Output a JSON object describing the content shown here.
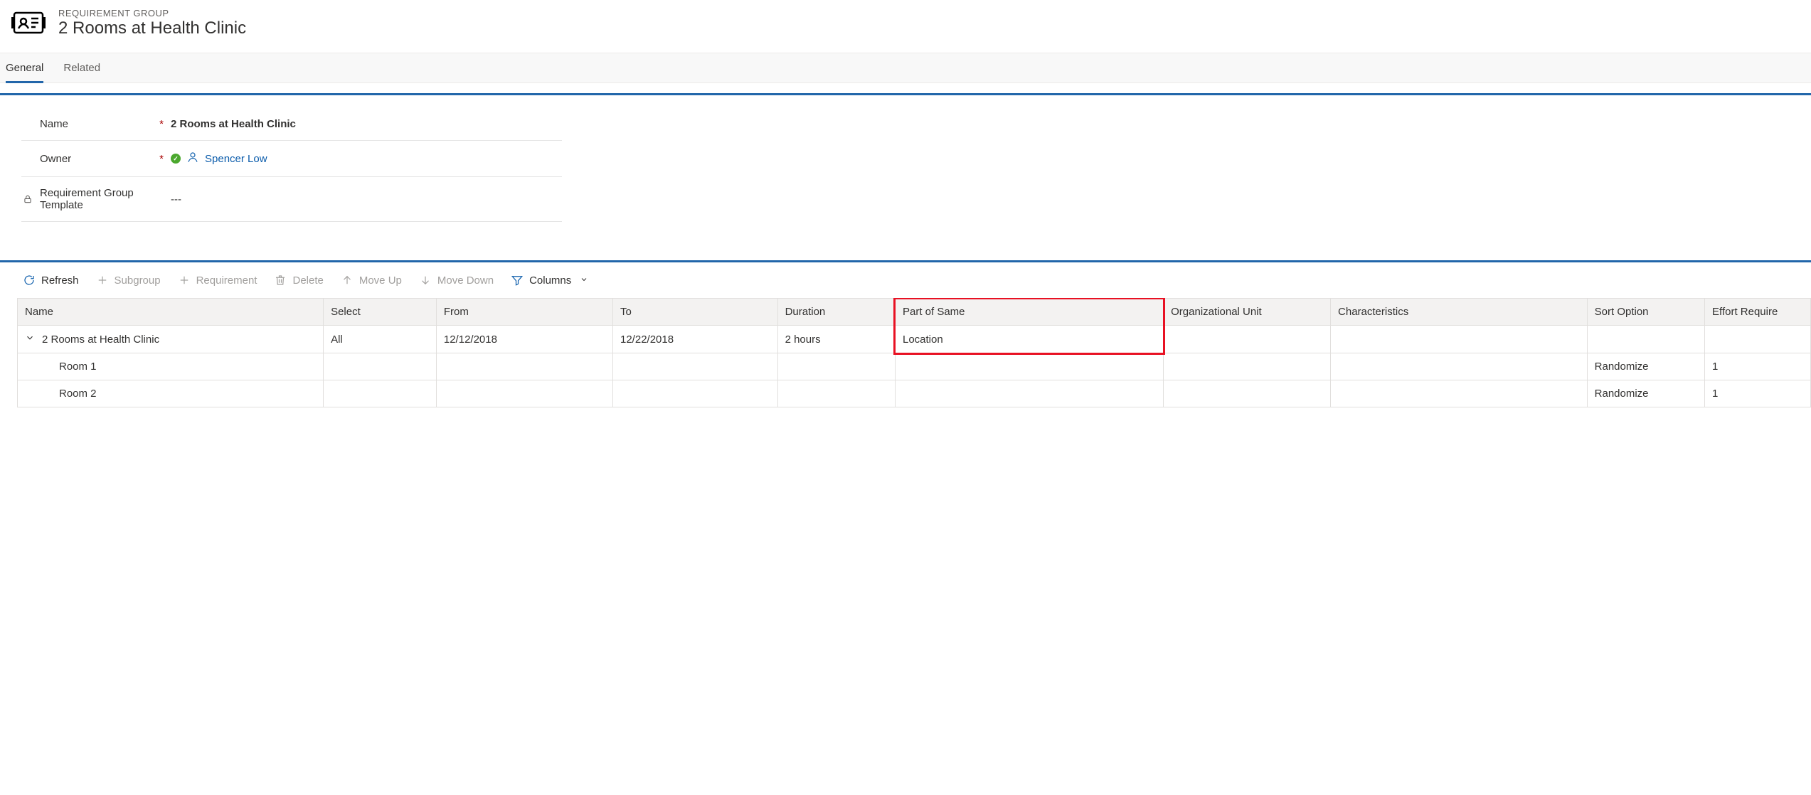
{
  "header": {
    "eyebrow": "REQUIREMENT GROUP",
    "title": "2 Rooms at Health Clinic"
  },
  "tabs": {
    "general": "General",
    "related": "Related"
  },
  "form": {
    "name_label": "Name",
    "name_value": "2 Rooms at Health Clinic",
    "owner_label": "Owner",
    "owner_value": "Spencer Low",
    "template_label": "Requirement Group Template",
    "template_value": "---"
  },
  "toolbar": {
    "refresh": "Refresh",
    "subgroup": "Subgroup",
    "requirement": "Requirement",
    "delete": "Delete",
    "move_up": "Move Up",
    "move_down": "Move Down",
    "columns": "Columns"
  },
  "grid": {
    "columns": {
      "name": "Name",
      "select": "Select",
      "from": "From",
      "to": "To",
      "duration": "Duration",
      "part_of_same": "Part of Same",
      "org_unit": "Organizational Unit",
      "characteristics": "Characteristics",
      "sort_option": "Sort Option",
      "effort_required": "Effort Require"
    },
    "rows": [
      {
        "name": "2 Rooms at Health Clinic",
        "select": "All",
        "from": "12/12/2018",
        "to": "12/22/2018",
        "duration": "2 hours",
        "part_of_same": "Location",
        "org_unit": "",
        "characteristics": "",
        "sort_option": "",
        "effort_required": "",
        "level": 0,
        "expandable": true
      },
      {
        "name": "Room 1",
        "select": "",
        "from": "",
        "to": "",
        "duration": "",
        "part_of_same": "",
        "org_unit": "",
        "characteristics": "",
        "sort_option": "Randomize",
        "effort_required": "1",
        "level": 1,
        "expandable": false
      },
      {
        "name": "Room 2",
        "select": "",
        "from": "",
        "to": "",
        "duration": "",
        "part_of_same": "",
        "org_unit": "",
        "characteristics": "",
        "sort_option": "Randomize",
        "effort_required": "1",
        "level": 1,
        "expandable": false
      }
    ]
  }
}
